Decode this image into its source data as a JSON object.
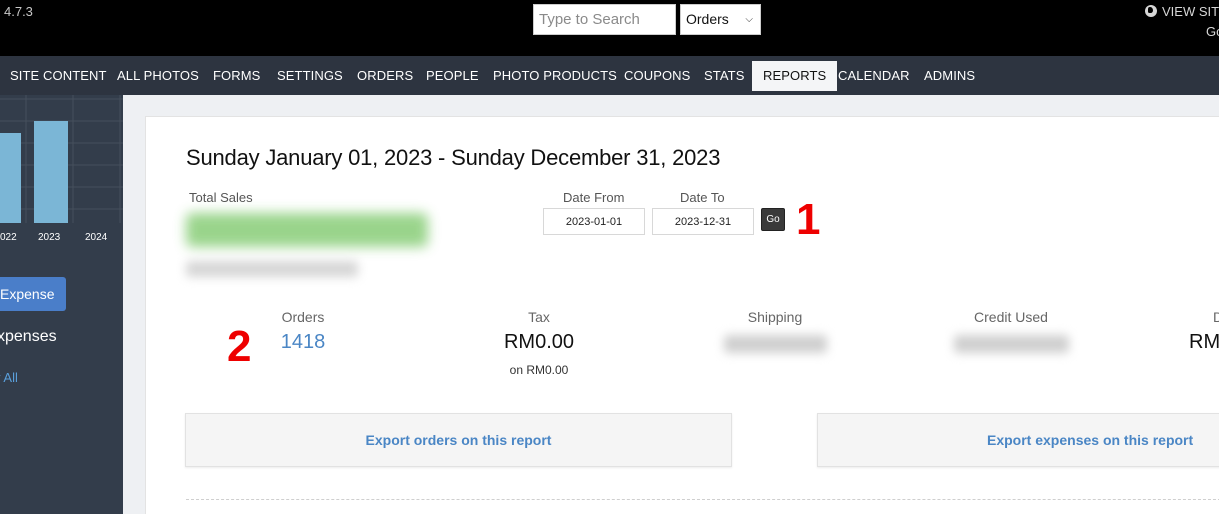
{
  "topbar": {
    "version": "4.7.3",
    "search_placeholder": "Type to Search",
    "search_scope": "Orders",
    "view_site": "VIEW SITE",
    "go": "Go"
  },
  "nav": {
    "items": [
      "SITE CONTENT",
      "ALL PHOTOS",
      "FORMS",
      "SETTINGS",
      "ORDERS",
      "PEOPLE",
      "PHOTO PRODUCTS",
      "COUPONS",
      "STATS",
      "REPORTS",
      "CALENDAR",
      "ADMINS"
    ],
    "active": "REPORTS"
  },
  "sidebar": {
    "years": [
      "022",
      "2023",
      "2024"
    ],
    "add_expense": "Expense",
    "expenses_title": "xpenses",
    "view_all": "v All"
  },
  "report": {
    "title": "Sunday January 01, 2023 - Sunday December 31, 2023",
    "total_sales_label": "Total Sales",
    "date_from_label": "Date From",
    "date_from": "2023-01-01",
    "date_to_label": "Date To",
    "date_to": "2023-12-31",
    "go_label": "Go",
    "stats": {
      "orders_label": "Orders",
      "orders_value": "1418",
      "tax_label": "Tax",
      "tax_value": "RM0.00",
      "tax_sub": "on RM0.00",
      "shipping_label": "Shipping",
      "credit_label": "Credit Used",
      "d_label": "D",
      "d_value": "RM"
    },
    "export_orders": "Export orders on this report",
    "export_expenses": "Export expenses on this report"
  },
  "annotations": [
    "1",
    "2"
  ],
  "colors": {
    "topbar": "#000000",
    "navbar": "#2d3440",
    "sidebar": "#333d4b",
    "link": "#4a86c5",
    "annotation": "#ee0000",
    "chart_bar": "#7bb6d6"
  }
}
